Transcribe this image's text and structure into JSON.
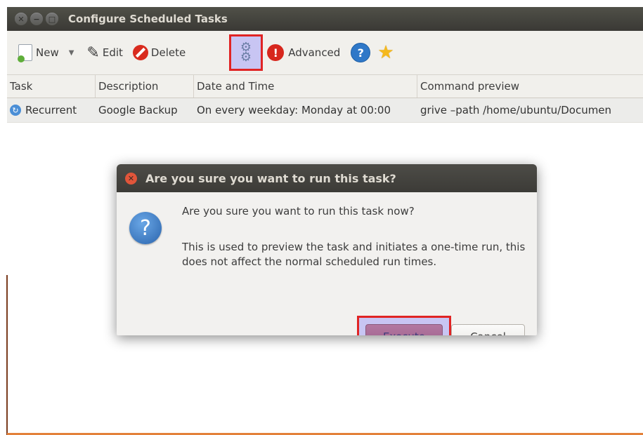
{
  "window": {
    "title": "Configure Scheduled Tasks"
  },
  "toolbar": {
    "new_label": "New",
    "edit_label": "Edit",
    "delete_label": "Delete",
    "advanced_label": "Advanced"
  },
  "table": {
    "columns": [
      "Task",
      "Description",
      "Date and Time",
      "Command preview"
    ],
    "rows": [
      {
        "task": "Recurrent",
        "description": "Google Backup",
        "datetime": "On every weekday: Monday at 00:00",
        "command": "grive –path /home/ubuntu/Documen"
      }
    ]
  },
  "dialog": {
    "title": "Are you sure you want to run this task?",
    "primary_text": "Are you sure you want to run this task now?",
    "secondary_text": "This is used to preview the task and initiates a one-time run, this does not affect the normal scheduled run times.",
    "execute_label": "Execute",
    "cancel_label": "Cancel"
  },
  "icons": {
    "new": "new-document-icon",
    "edit": "pencil-icon",
    "delete": "delete-icon",
    "run": "gears-icon",
    "template": "plug-icon",
    "advanced": "advanced-icon",
    "help": "help-icon",
    "about": "star-icon",
    "recurrent": "recurrent-icon",
    "dialog": "question-icon"
  },
  "colors": {
    "titlebar": "#3c3b37",
    "highlight_border": "#e02424",
    "execute_button": "#a56791"
  }
}
